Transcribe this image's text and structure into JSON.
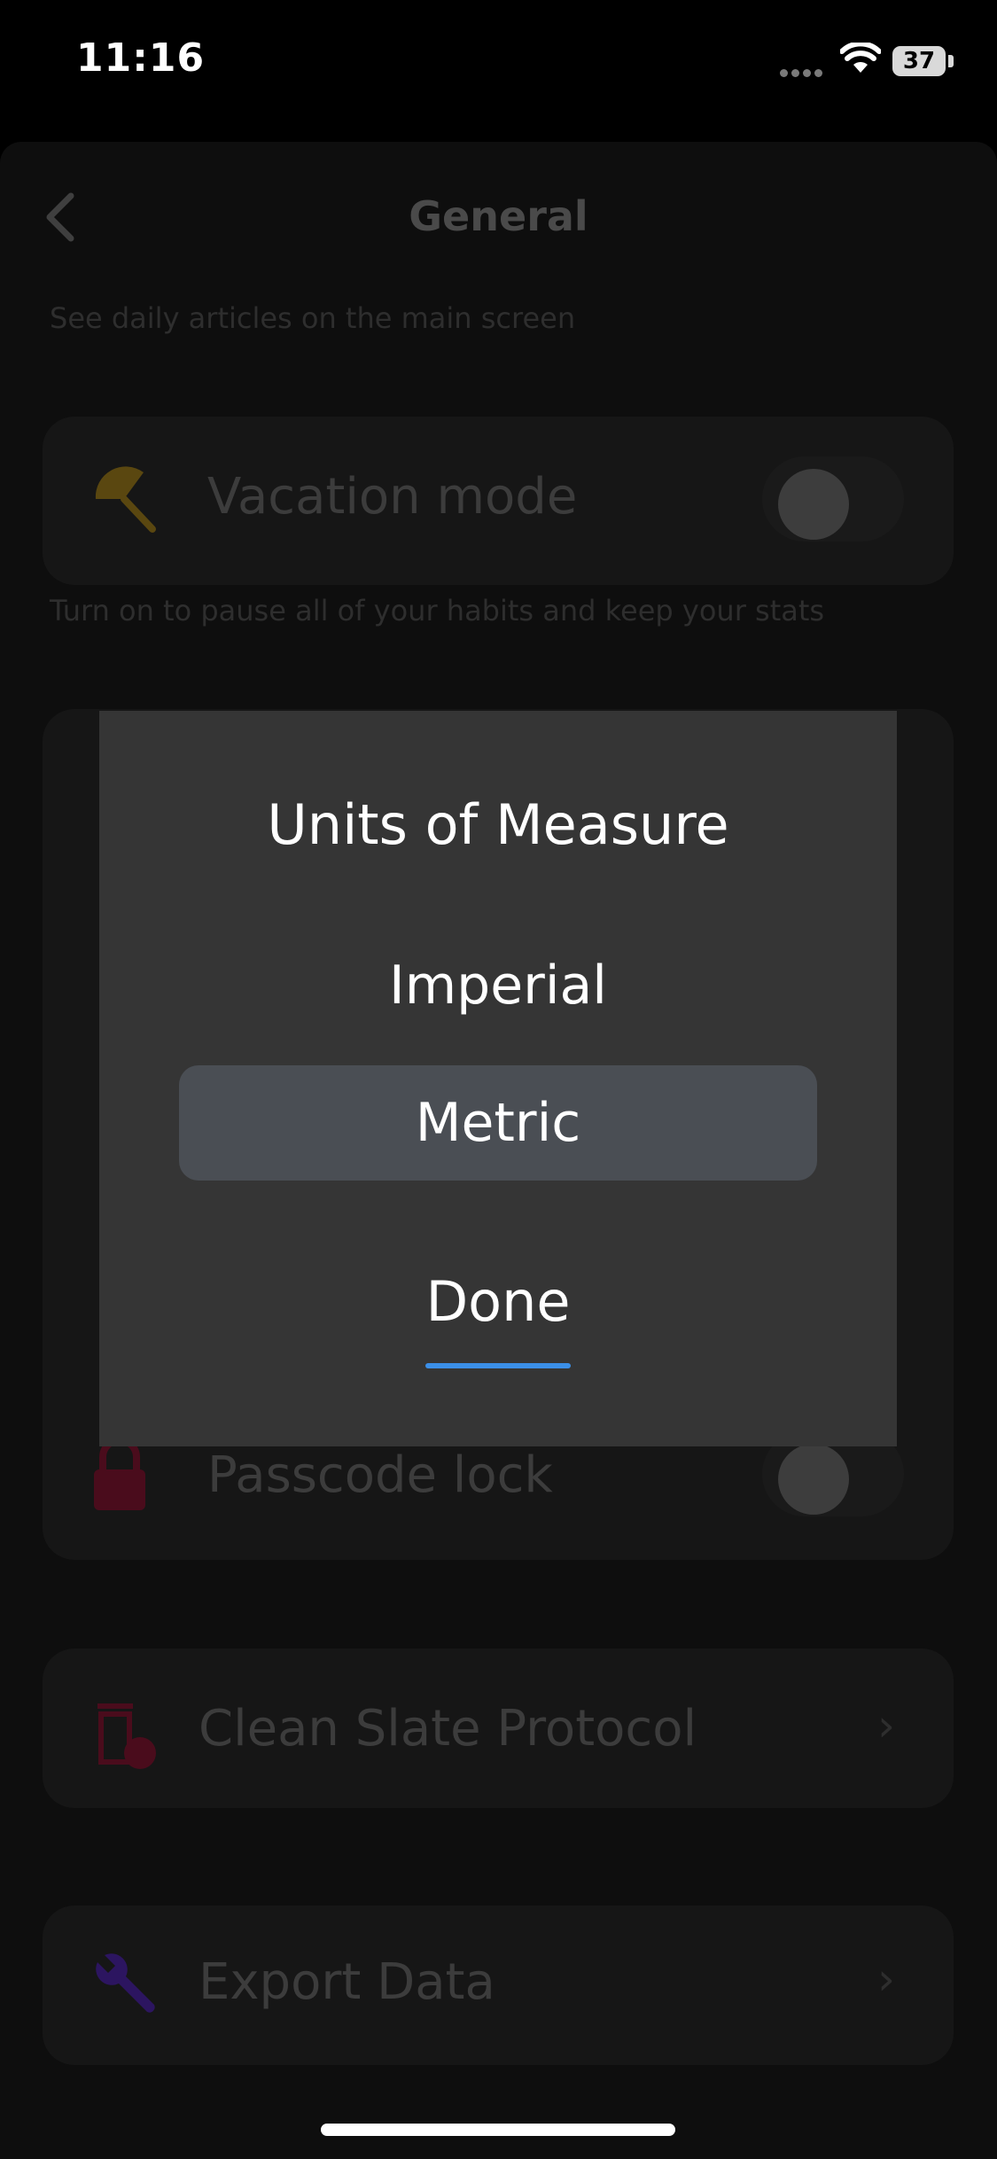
{
  "status": {
    "time": "11:16",
    "battery": "37"
  },
  "header": {
    "title": "General"
  },
  "articles_hint": "See daily articles on the main screen",
  "vacation": {
    "label": "Vacation mode",
    "hint": "Turn on to pause all of your habits and keep your stats",
    "on": false
  },
  "passcode": {
    "label": "Passcode lock",
    "on": false
  },
  "clean_slate": {
    "label": "Clean Slate Protocol"
  },
  "export": {
    "label": "Export Data"
  },
  "dialog": {
    "title": "Units of Measure",
    "options": [
      "Imperial",
      "Metric"
    ],
    "selected": "Metric",
    "done_label": "Done"
  },
  "colors": {
    "accent": "#3b8fe8",
    "dialog_bg": "#353535",
    "selected_bg": "#4a4e54"
  }
}
